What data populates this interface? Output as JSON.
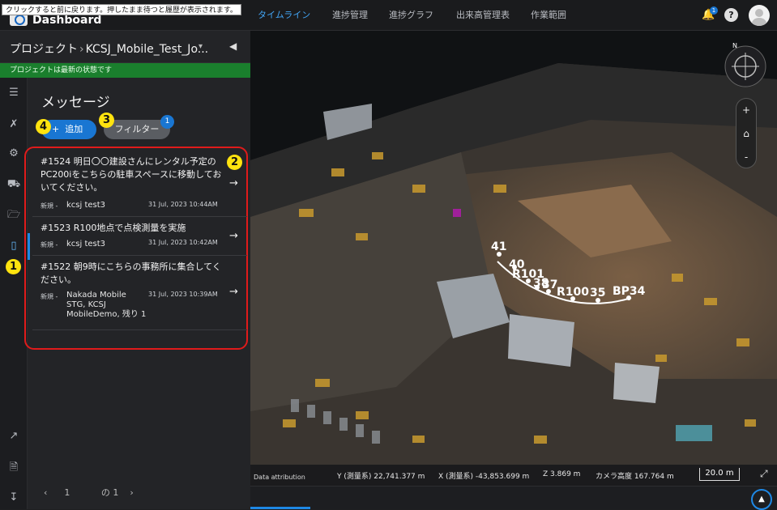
{
  "tooltip": "クリックすると前に戻ります。押したまま待つと履歴が表示されます。",
  "header": {
    "title": "Dashboard",
    "notification_count": "1",
    "help_label": "?"
  },
  "project": {
    "label": "プロジェクト",
    "name": "KCSJ_Mobile_Test_Jo..."
  },
  "status_message": "プロジェクトは最新の状態です",
  "rail": {
    "icons": [
      "layers-icon",
      "tools-icon",
      "settings-icon",
      "machinery-icon",
      "folder-icon",
      "mobile-icon",
      "export-icon",
      "pdf-icon",
      "download-icon"
    ]
  },
  "messages": {
    "title": "メッセージ",
    "add_label": "追加",
    "filter_label": "フィルター",
    "filter_count": "1",
    "items": [
      {
        "title": "#1524 明日〇〇建設さんにレンタル予定のPC200iをこちらの駐車スペースに移動しておいてください。",
        "status": "新規",
        "user": "kcsj test3",
        "date": "31 Jul, 2023 10:44AM"
      },
      {
        "title": "#1523 R100地点で点検測量を実施",
        "status": "新規",
        "user": "kcsj test3",
        "date": "31 Jul, 2023 10:42AM"
      },
      {
        "title": "#1522 朝9時にこちらの事務所に集合してください。",
        "status": "新規",
        "user": "Nakada Mobile STG, KCSJ MobileDemo, 残り 1",
        "date": "31 Jul, 2023 10:39AM"
      }
    ]
  },
  "pager": {
    "current": "1",
    "total_text": "の 1"
  },
  "markers": [
    "1",
    "2",
    "3",
    "4"
  ],
  "map": {
    "north_label": "N",
    "point_labels": [
      "41",
      "40",
      "R101",
      "38",
      "37",
      "R100",
      "35",
      "BP34"
    ],
    "attribution": "Data attribution",
    "coords": {
      "y": "Y (測量系) 22,741.377 m",
      "x": "X (測量系) -43,853.699 m",
      "z": "Z 3.869 m",
      "camera": "カメラ高度 167.764 m"
    },
    "scale": "20.0 m",
    "zoom_in": "+",
    "zoom_out": "-"
  },
  "bottom_tabs": [
    "タイムライン",
    "進捗管理",
    "進捗グラフ",
    "出来高管理表",
    "作業範囲"
  ],
  "colors": {
    "accent": "#1976d2",
    "status_green": "#1a7f2d",
    "highlight_border": "#e01b1b",
    "marker_yellow": "#ffe30f"
  }
}
